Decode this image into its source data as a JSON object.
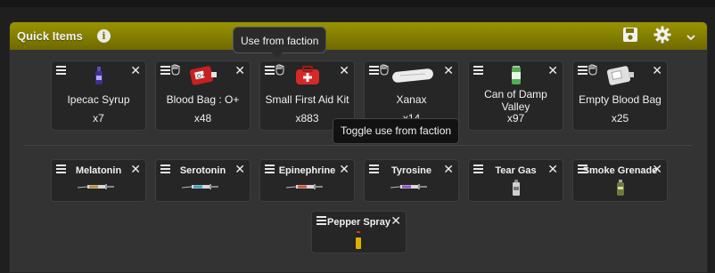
{
  "panel": {
    "title": "Quick Items",
    "info_icon": "info-icon",
    "save_icon": "save-icon",
    "settings_icon": "gear-icon",
    "collapse_icon": "chevron-down-icon",
    "header_color": "#8a8400"
  },
  "tooltips": {
    "use_from_faction": "Use from faction",
    "toggle_use_from_faction": "Toggle use from faction"
  },
  "items_row1": [
    {
      "name": "Ipecac Syrup",
      "qty": "x7",
      "faction_toggle": false,
      "icon": "syrup-bottle-icon"
    },
    {
      "name": "Blood Bag : O+",
      "qty": "x48",
      "faction_toggle": true,
      "icon": "blood-bag-icon"
    },
    {
      "name": "Small First Aid Kit",
      "qty": "x883",
      "faction_toggle": true,
      "icon": "first-aid-kit-icon"
    },
    {
      "name": "Xanax",
      "qty": "x14",
      "faction_toggle": true,
      "icon": "xanax-pill-icon"
    },
    {
      "name": "Can of Damp Valley",
      "qty": "x97",
      "faction_toggle": false,
      "icon": "drink-can-icon"
    },
    {
      "name": "Empty Blood Bag",
      "qty": "x25",
      "faction_toggle": true,
      "icon": "empty-blood-bag-icon"
    }
  ],
  "items_row2": [
    {
      "name": "Melatonin",
      "icon": "syringe-icon"
    },
    {
      "name": "Serotonin",
      "icon": "syringe-icon"
    },
    {
      "name": "Epinephrine",
      "icon": "syringe-icon"
    },
    {
      "name": "Tyrosine",
      "icon": "syringe-icon"
    },
    {
      "name": "Tear Gas",
      "icon": "tear-gas-canister-icon"
    },
    {
      "name": "Smoke Grenade",
      "icon": "smoke-grenade-icon"
    },
    {
      "name": "Pepper Spray",
      "icon": "pepper-spray-icon"
    }
  ]
}
